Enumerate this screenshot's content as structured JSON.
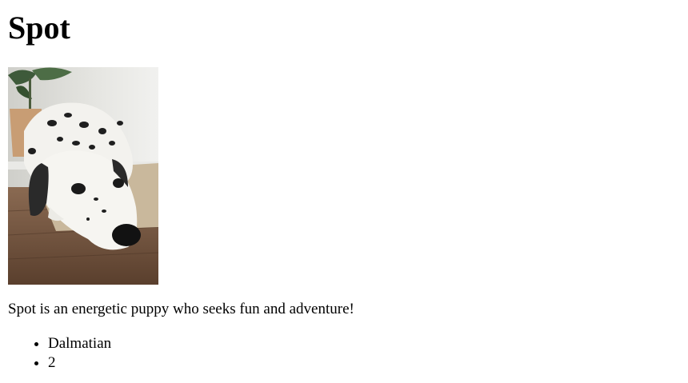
{
  "heading": "Spot",
  "photo": {
    "subject": "dalmatian-puppy-lying-on-floor"
  },
  "description": "Spot is an energetic puppy who seeks fun and adventure!",
  "details": [
    "Dalmatian",
    "2"
  ]
}
